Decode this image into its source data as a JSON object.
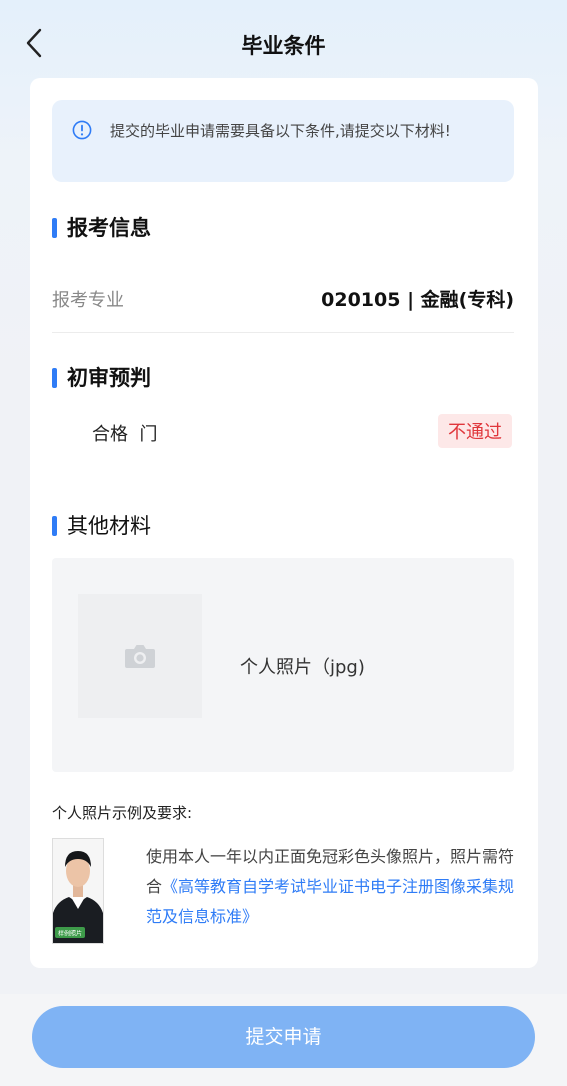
{
  "header": {
    "title": "毕业条件"
  },
  "notice": {
    "text": "提交的毕业申请需要具备以下条件,请提交以下材料!"
  },
  "sections": {
    "exam_info": {
      "title": "报考信息",
      "major_label": "报考专业",
      "major_value": "020105 | 金融(专科)"
    },
    "preliminary": {
      "title": "初审预判",
      "pass_label": "合格  门",
      "status": "不通过"
    },
    "materials": {
      "title": "其他材料",
      "upload_label": "个人照片（jpg)",
      "camera_icon": "camera-icon"
    }
  },
  "requirements": {
    "title": "个人照片示例及要求:",
    "text_before": "使用本人一年以内正面免冠彩色头像照片，照片需符合",
    "link": "《高等教育自学考试毕业证书电子注册图像采集规范及信息标准》",
    "sample_tag": "样例照片"
  },
  "footer": {
    "submit_label": "提交申请"
  },
  "colors": {
    "accent": "#2f7cf6",
    "fail_text": "#e0363b",
    "fail_bg": "#fde8e8",
    "button": "#7fb3f4",
    "notice_bg": "#e8f1fc"
  }
}
